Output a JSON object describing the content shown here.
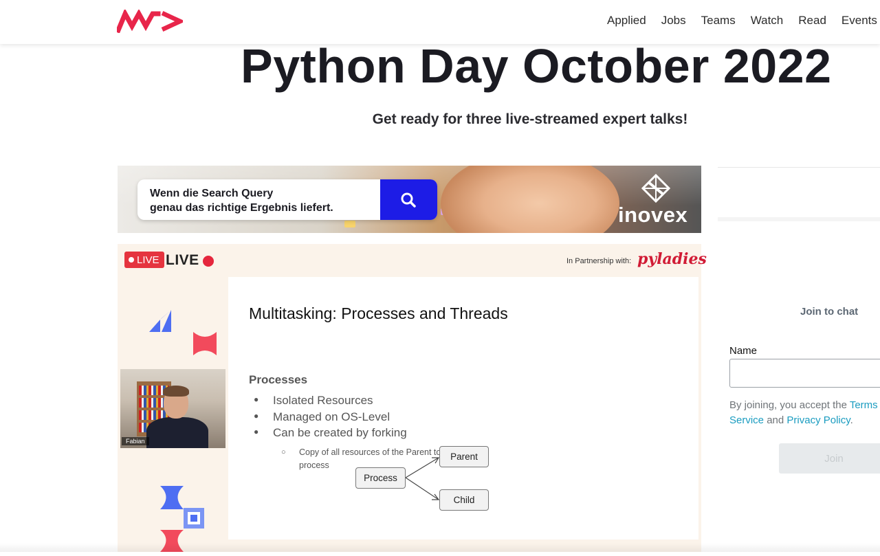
{
  "header": {
    "logo_icon": "wearedevelopers-logo",
    "brand_color": "#e8254a",
    "nav": [
      "Applied",
      "Jobs",
      "Teams",
      "Watch",
      "Read",
      "Events"
    ]
  },
  "hero": {
    "title": "Python Day October 2022",
    "subtitle": "Get ready for three live-streamed expert talks!"
  },
  "ad": {
    "search_line1": "Wenn die Search Query",
    "search_line2": "genau das richtige Ergebnis liefert.",
    "search_icon": "search-icon",
    "button_color": "#1d1ce6",
    "brand": "inovex"
  },
  "stream": {
    "live_badge": "LIVE",
    "live_text": "LIVE",
    "partner_label": "In Partnership with:",
    "partner": "pyladies",
    "speaker_name": "Fabian",
    "slide": {
      "title": "Multitasking: Processes and Threads",
      "section": "Processes",
      "bullets": [
        "Isolated Resources",
        "Managed on OS-Level",
        "Can be created by forking"
      ],
      "sub_bullet": "Copy of all resources of the Parent to a new Child process",
      "diagram": {
        "root": "Process",
        "children": [
          "Parent",
          "Child"
        ]
      }
    }
  },
  "chat": {
    "heading": "Join to chat",
    "name_label": "Name",
    "name_value": "",
    "terms_prefix": "By joining, you accept the ",
    "terms_link": "Terms of Service",
    "terms_and": " and ",
    "privacy_link": "Privacy Policy",
    "terms_suffix": ".",
    "join_button": "Join"
  }
}
